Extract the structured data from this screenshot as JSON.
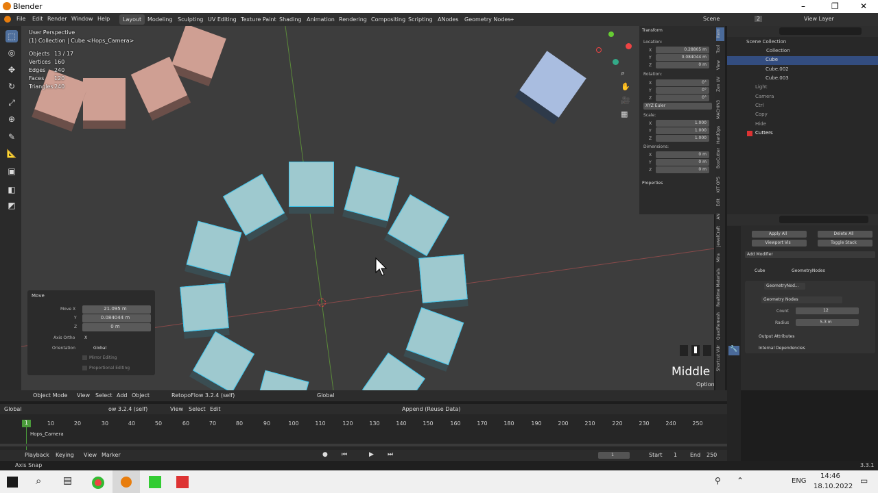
{
  "window": {
    "title": "Blender",
    "minimize": "–",
    "maximize": "❐",
    "close": "✕"
  },
  "menu": [
    "File",
    "Edit",
    "Render",
    "Window",
    "Help"
  ],
  "workspaces": [
    "Layout",
    "Modeling",
    "Sculpting",
    "UV Editing",
    "Texture Paint",
    "Shading",
    "Animation",
    "Rendering",
    "Compositing",
    "Scripting",
    "ANodes",
    "Geometry Nodes",
    "+"
  ],
  "scene": {
    "label": "Scene",
    "count": "2",
    "view_layer": "View Layer"
  },
  "viewport": {
    "perspective": "User Perspective",
    "collection": "(1) Collection | Cube <Hops_Camera>",
    "stats": [
      {
        "label": "Objects",
        "value": "13 / 17"
      },
      {
        "label": "Vertices",
        "value": "160"
      },
      {
        "label": "Edges",
        "value": "240"
      },
      {
        "label": "Faces",
        "value": "120"
      },
      {
        "label": "Triangles",
        "value": "240"
      }
    ],
    "middle_label": "Middle",
    "options": "Options"
  },
  "transform_panel": {
    "title": "Transform",
    "location_label": "Location:",
    "location": {
      "x": "0.28805 m",
      "y": "0.084044 m",
      "z": "0 m"
    },
    "rotation_label": "Rotation:",
    "rotation": {
      "x": "0°",
      "y": "0°",
      "z": "0°"
    },
    "euler": "XYZ Euler",
    "scale_label": "Scale:",
    "scale": {
      "x": "1.000",
      "y": "1.000",
      "z": "1.000"
    },
    "dimensions_label": "Dimensions:",
    "dimensions": {
      "x": "0 m",
      "y": "0 m",
      "z": "0 m"
    },
    "properties": "Properties"
  },
  "ntabs": [
    "Item",
    "Tool",
    "View",
    "Zen UV",
    "MACHIN3",
    "HardOps",
    "BoxCutter",
    "KIT OPS",
    "Edit",
    "AN",
    "JewelCraft",
    "Mira",
    "Realtime Materials",
    "QuadRemesh",
    "Shortcut VUr"
  ],
  "move_panel": {
    "title": "Move",
    "move_x_label": "Move X",
    "move_x": "21.095 m",
    "y_label": "Y",
    "y": "0.084044 m",
    "z_label": "Z",
    "z": "0 m",
    "axis_ortho_label": "Axis Ortho",
    "axis_ortho": "X",
    "orientation_label": "Orientation",
    "orientation": "Global",
    "mirror": "Mirror Editing",
    "proportional": "Proportional Editing"
  },
  "outliner": {
    "rows": [
      {
        "name": "Scene Collection",
        "indent": 0
      },
      {
        "name": "Collection",
        "indent": 1
      },
      {
        "name": "Cube",
        "indent": 2
      },
      {
        "name": "Cube.002",
        "indent": 2
      },
      {
        "name": "Cube.003",
        "indent": 2
      },
      {
        "name": "Light",
        "indent": 1
      },
      {
        "name": "Camera",
        "indent": 1
      },
      {
        "name": "Ctrl",
        "indent": 1
      },
      {
        "name": "Copy",
        "indent": 1
      },
      {
        "name": "Hide",
        "indent": 1
      },
      {
        "name": "Cutters",
        "indent": 1
      }
    ]
  },
  "properties": {
    "apply_all": "Apply All",
    "delete_all": "Delete All",
    "viewport_vis": "Viewport Vis",
    "toggle_stack": "Toggle Stack",
    "add_modifier": "Add Modifier",
    "object": "Cube",
    "modifier": "GeometryNodes",
    "modifier_short": "GeometryNod...",
    "node_group": "Geometry Nodes",
    "count_label": "Count",
    "count": "12",
    "radius_label": "Radius",
    "radius": "5.3 m",
    "output_attributes": "Output Attributes",
    "internal_dependencies": "Internal Dependencies"
  },
  "viewport_header": {
    "mode": "Object Mode",
    "view": "View",
    "select": "Select",
    "add": "Add",
    "object": "Object",
    "addon": "RetopoFlow 3.2.4 (self)",
    "orientation": "Global"
  },
  "timeline_header": {
    "orientation": "Global",
    "addon": "ow 3.2.4 (self)",
    "view": "View",
    "select": "Select",
    "edit": "Edit",
    "append": "Append (Reuse Data)"
  },
  "timeline": {
    "current_frame_marker": "1",
    "ticks": [
      "10",
      "20",
      "30",
      "40",
      "50",
      "60",
      "70",
      "80",
      "90",
      "100",
      "110",
      "120",
      "130",
      "140",
      "150",
      "160",
      "170",
      "180",
      "190",
      "200",
      "210",
      "220",
      "230",
      "240",
      "250"
    ],
    "track": "Hops_Camera"
  },
  "playback": {
    "playback": "Playback",
    "keying": "Keying",
    "view": "View",
    "marker": "Marker",
    "frame": "1",
    "start_label": "Start",
    "start": "1",
    "end_label": "End",
    "end": "250"
  },
  "statusbar": {
    "left": "Axis Snap",
    "version": "3.3.1"
  },
  "taskbar": {
    "lang": "ENG",
    "time": "14:46",
    "date": "18.10.2022"
  }
}
